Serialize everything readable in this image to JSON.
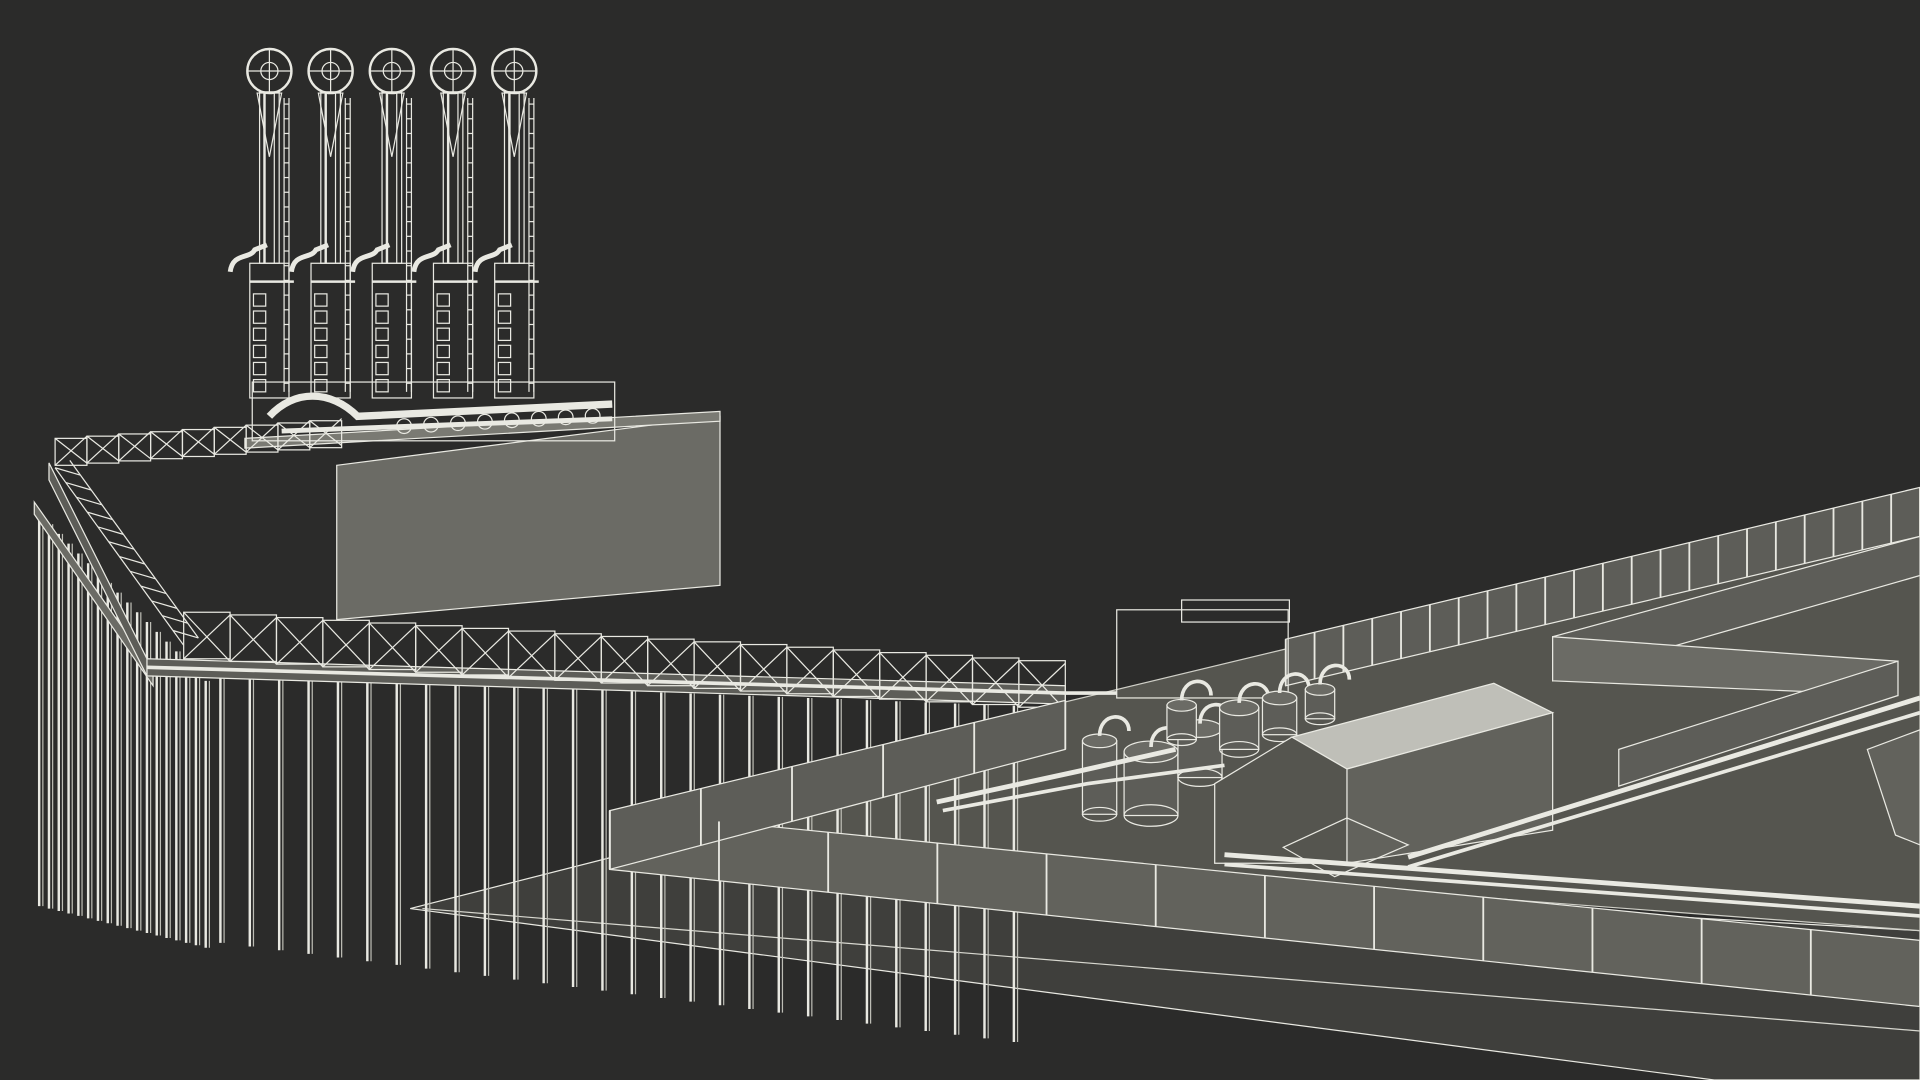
{
  "scene": {
    "colors": {
      "background": "#2b2b2a",
      "wireframe": "#e9e9e2",
      "surface_light": "#6b6b65",
      "surface_mid": "#5d5d58",
      "surface_dark": "#4a4a46",
      "ground": "#3f3f3c"
    },
    "objects": {
      "loading_arms": 5,
      "trestle_piles": 46,
      "storage_tanks": 7,
      "wall_panels_front": 12
    }
  }
}
